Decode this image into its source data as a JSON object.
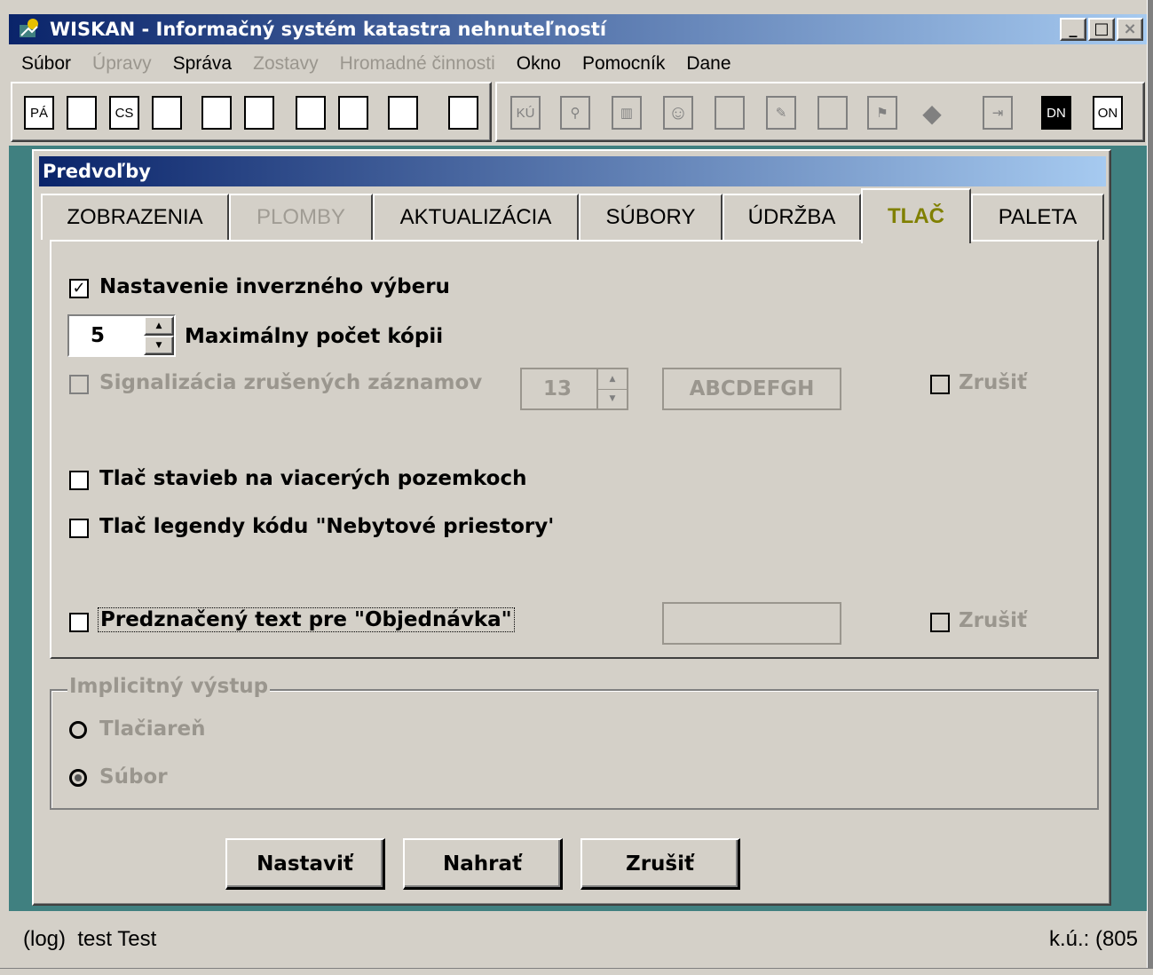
{
  "window": {
    "title": "WISKAN - Informačný systém katastra nehnuteľností",
    "buttons": [
      "_",
      "□",
      "×"
    ]
  },
  "menu": [
    {
      "label": "Súbor",
      "enabled": true
    },
    {
      "label": "Úpravy",
      "enabled": false
    },
    {
      "label": "Správa",
      "enabled": true
    },
    {
      "label": "Zostavy",
      "enabled": false
    },
    {
      "label": "Hromadné činnosti",
      "enabled": false
    },
    {
      "label": "Okno",
      "enabled": true
    },
    {
      "label": "Pomocník",
      "enabled": true
    },
    {
      "label": "Dane",
      "enabled": true
    }
  ],
  "toolbar": {
    "left": [
      "PÁ",
      "",
      "CS",
      "",
      "",
      "",
      "",
      "",
      "",
      "",
      "",
      ""
    ],
    "right": [
      "KÚ",
      "",
      "",
      "☺",
      "",
      "",
      "",
      "",
      "◆",
      "",
      "DN",
      "ON"
    ]
  },
  "dialog": {
    "title": "Predvoľby",
    "tabs": [
      "ZOBRAZENIA",
      "PLOMBY",
      "AKTUALIZÁCIA",
      "SÚBORY",
      "ÚDRŽBA",
      "TLAČ",
      "PALETA"
    ],
    "active_tab": "TLAČ",
    "options": {
      "inverse_selection": {
        "label": "Nastavenie inverzného výberu",
        "checked": true
      },
      "max_copies": {
        "label": "Maximálny počet kópii",
        "value": "5"
      },
      "signal_deleted": {
        "label": "Signalizácia zrušených záznamov",
        "checked": false,
        "spin_value": "13",
        "text_value": "ABCDEFGH",
        "cancel_label": "Zrušiť"
      },
      "print_buildings": {
        "label": "Tlač stavieb na viacerých pozemkoch",
        "checked": false
      },
      "print_legend": {
        "label": "Tlač legendy  kódu \"Nebytové priestory'",
        "checked": false
      },
      "preprinted_text": {
        "label": "Predznačený text pre \"Objednávka\"",
        "checked": false,
        "text_value": "",
        "cancel_label": "Zrušiť"
      }
    },
    "output_group": {
      "legend": "Implicitný výstup",
      "options": [
        {
          "label": "Tlačiareň",
          "selected": false
        },
        {
          "label": "Súbor",
          "selected": true
        }
      ]
    },
    "buttons": {
      "set": "Nastaviť",
      "load": "Nahrať",
      "cancel": "Zrušiť"
    }
  },
  "status": {
    "left": "(log)  test Test",
    "right": "k.ú.: (805"
  }
}
